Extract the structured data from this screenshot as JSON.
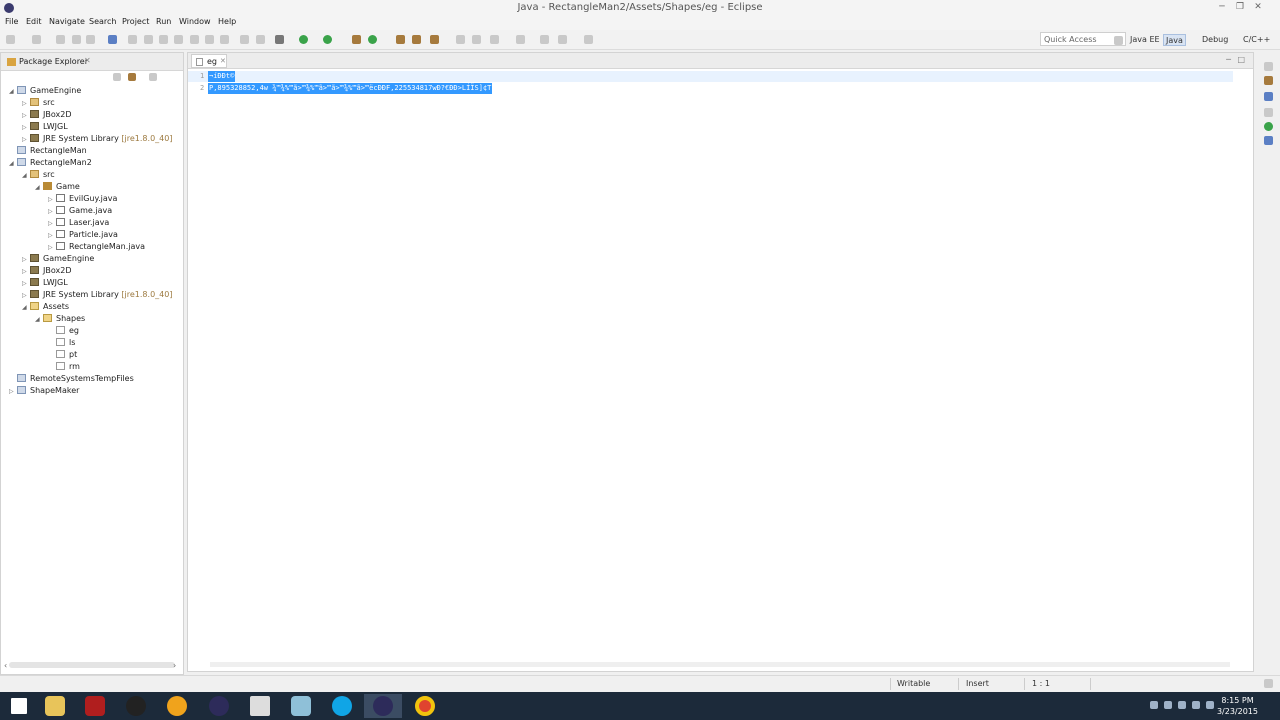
{
  "window": {
    "title": "Java - RectangleMan2/Assets/Shapes/eg - Eclipse"
  },
  "menu": [
    "File",
    "Edit",
    "Navigate",
    "Search",
    "Project",
    "Run",
    "Window",
    "Help"
  ],
  "toolbar": {
    "quick_access": "Quick Access",
    "perspectives": [
      "Java EE",
      "Java",
      "Debug",
      "C/C++"
    ],
    "active_perspective": "Java"
  },
  "explorer": {
    "title": "Package Explorer",
    "tree": [
      {
        "label": "GameEngine",
        "expanded": true,
        "icon": "project-icon"
      },
      {
        "label": "src",
        "icon": "source-folder-icon"
      },
      {
        "label": "JBox2D",
        "icon": "library-icon"
      },
      {
        "label": "LWJGL",
        "icon": "library-icon"
      },
      {
        "label": "JRE System Library",
        "suffix": "[jre1.8.0_40]",
        "icon": "library-icon"
      },
      {
        "label": "RectangleMan",
        "icon": "project-icon"
      },
      {
        "label": "RectangleMan2",
        "expanded": true,
        "icon": "project-icon"
      },
      {
        "label": "src",
        "expanded": true,
        "icon": "source-folder-icon"
      },
      {
        "label": "Game",
        "expanded": true,
        "icon": "package-icon"
      },
      {
        "label": "EvilGuy.java",
        "icon": "java-file-icon"
      },
      {
        "label": "Game.java",
        "icon": "java-file-icon"
      },
      {
        "label": "Laser.java",
        "icon": "java-file-icon"
      },
      {
        "label": "Particle.java",
        "icon": "java-file-icon"
      },
      {
        "label": "RectangleMan.java",
        "icon": "java-file-icon"
      },
      {
        "label": "GameEngine",
        "icon": "library-icon"
      },
      {
        "label": "JBox2D",
        "icon": "library-icon"
      },
      {
        "label": "LWJGL",
        "icon": "library-icon"
      },
      {
        "label": "JRE System Library",
        "suffix": "[jre1.8.0_40]",
        "icon": "library-icon"
      },
      {
        "label": "Assets",
        "expanded": true,
        "icon": "folder-icon"
      },
      {
        "label": "Shapes",
        "expanded": true,
        "icon": "folder-icon"
      },
      {
        "label": "eg",
        "icon": "file-icon"
      },
      {
        "label": "ls",
        "icon": "file-icon"
      },
      {
        "label": "pt",
        "icon": "file-icon"
      },
      {
        "label": "rm",
        "icon": "file-icon"
      },
      {
        "label": "RemoteSystemsTempFiles",
        "icon": "project-icon"
      },
      {
        "label": "ShapeMaker",
        "icon": "project-icon"
      }
    ]
  },
  "editor": {
    "tab_label": "eg",
    "lines": [
      {
        "num": "1",
        "text": "¬íÐÐt©"
      },
      {
        "num": "2",
        "text": "P,895328852,4w ¾™¾%™ã>™¾%™ã>™ã>™¾%™ã>™ëcÐÐF,225534817wÐ?€ÐÐ>LÍÏS]¢T"
      }
    ]
  },
  "status": {
    "writable": "Writable",
    "insert_mode": "Insert",
    "position": "1 : 1"
  },
  "taskbar": {
    "time": "8:15 PM",
    "date": "3/23/2015"
  }
}
